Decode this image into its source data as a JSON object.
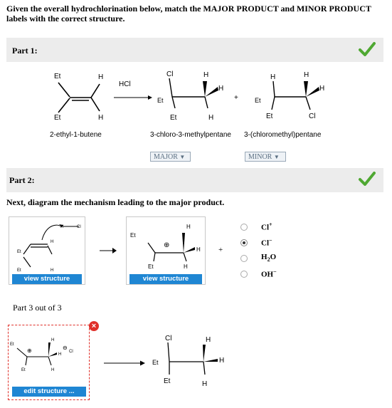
{
  "question": "Given the overall hydrochlorination below, match the MAJOR PRODUCT and MINOR PRODUCT labels with the correct structure.",
  "part1": {
    "label": "Part 1:",
    "reagent": "HCl",
    "plus": "+",
    "names": [
      "2-ethyl-1-butene",
      "3-chloro-3-methylpentane",
      "3-(chloromethyl)pentane"
    ],
    "dropdowns": [
      "MAJOR",
      "MINOR"
    ],
    "correct": true
  },
  "part2": {
    "label": "Part 2:",
    "prompt": "Next, diagram the mechanism leading to the major product.",
    "view_button": "view structure",
    "plus": "+",
    "options": [
      {
        "label": "Cl",
        "sup": "+",
        "sub": "",
        "selected": false
      },
      {
        "label": "Cl",
        "sup": "−",
        "sub": "",
        "selected": true
      },
      {
        "label": "H",
        "sup": "",
        "sub": "2",
        "tail": "O",
        "selected": false
      },
      {
        "label": "OH",
        "sup": "−",
        "sub": "",
        "selected": false
      }
    ],
    "correct": true
  },
  "part3": {
    "label": "Part 3 out of 3",
    "edit_button": "edit structure ...",
    "close_icon": "×"
  },
  "labels": {
    "Et": "Et",
    "H": "H",
    "Cl": "Cl",
    "plus_charge": "⊕",
    "minus_charge": "⊖"
  },
  "colors": {
    "accent": "#1f86d3",
    "check": "#4fa832",
    "error": "#e0302a"
  }
}
